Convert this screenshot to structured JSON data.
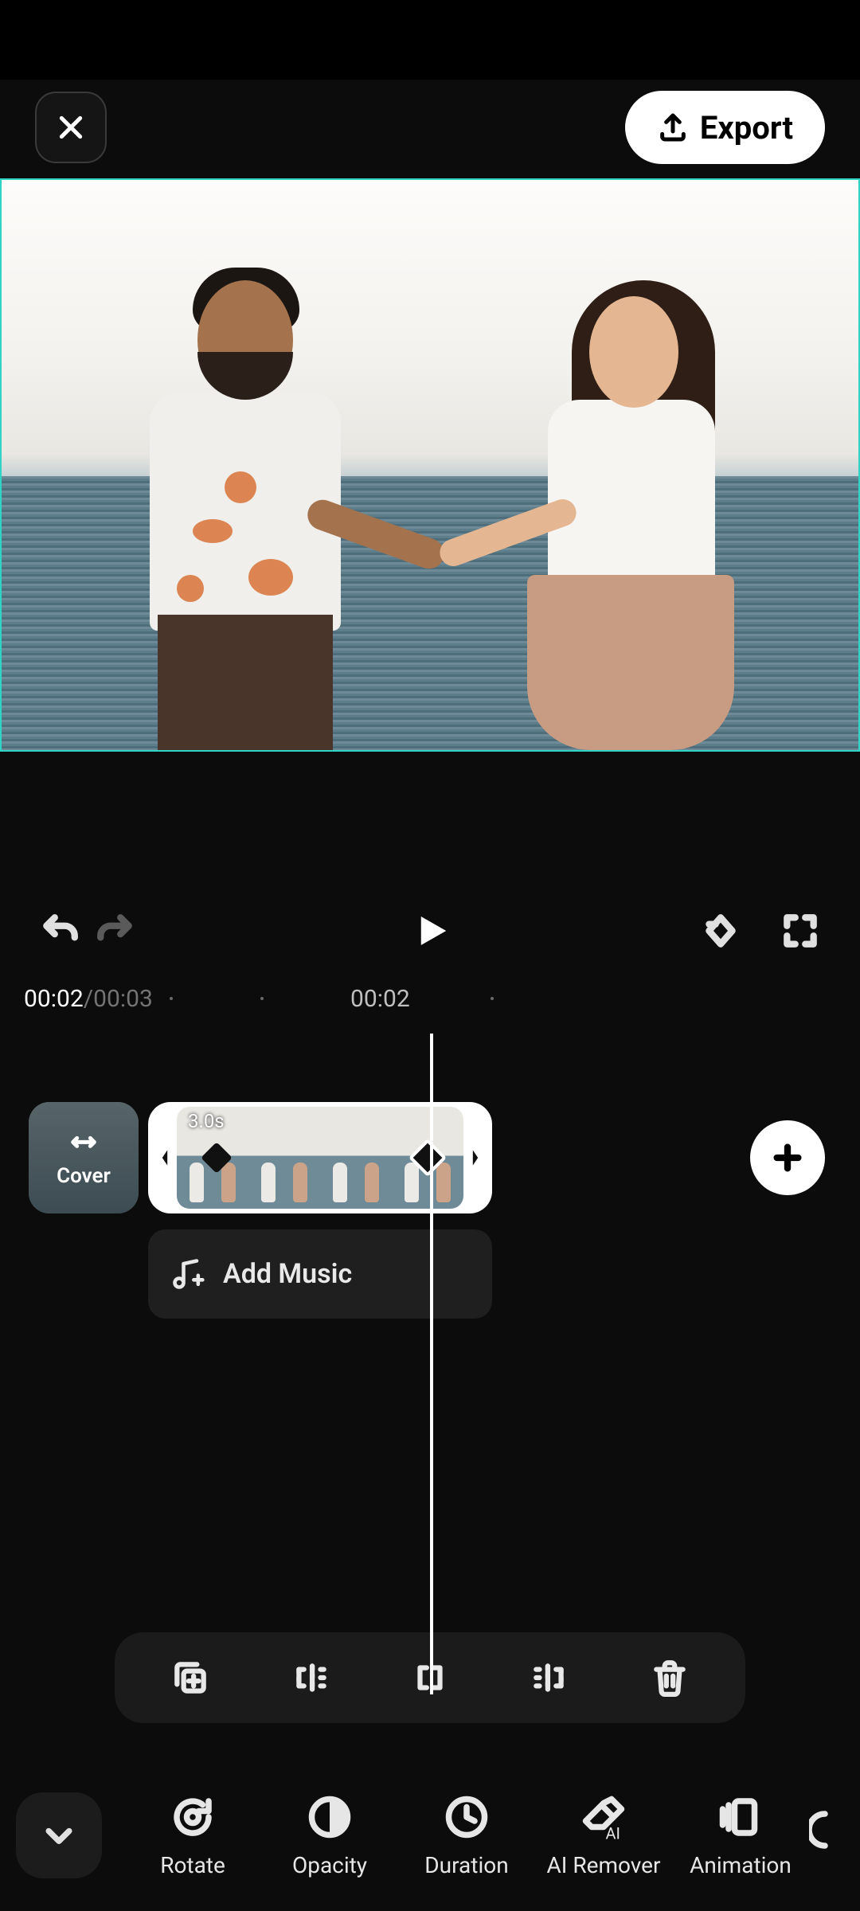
{
  "header": {
    "export_label": "Export"
  },
  "playback": {
    "current_time": "00:02",
    "total_time": "00:03",
    "separator": " / ",
    "ruler_mark": "00:02"
  },
  "timeline": {
    "cover_label": "Cover",
    "clip_duration": "3.0s",
    "add_music_label": "Add Music"
  },
  "tools": {
    "rotate": "Rotate",
    "opacity": "Opacity",
    "duration": "Duration",
    "ai_remover": "AI Remover",
    "animation": "Animation"
  },
  "colors": {
    "accent": "#2fd4c7",
    "bg": "#0c0c0c",
    "chip": "#1f1f1f"
  }
}
